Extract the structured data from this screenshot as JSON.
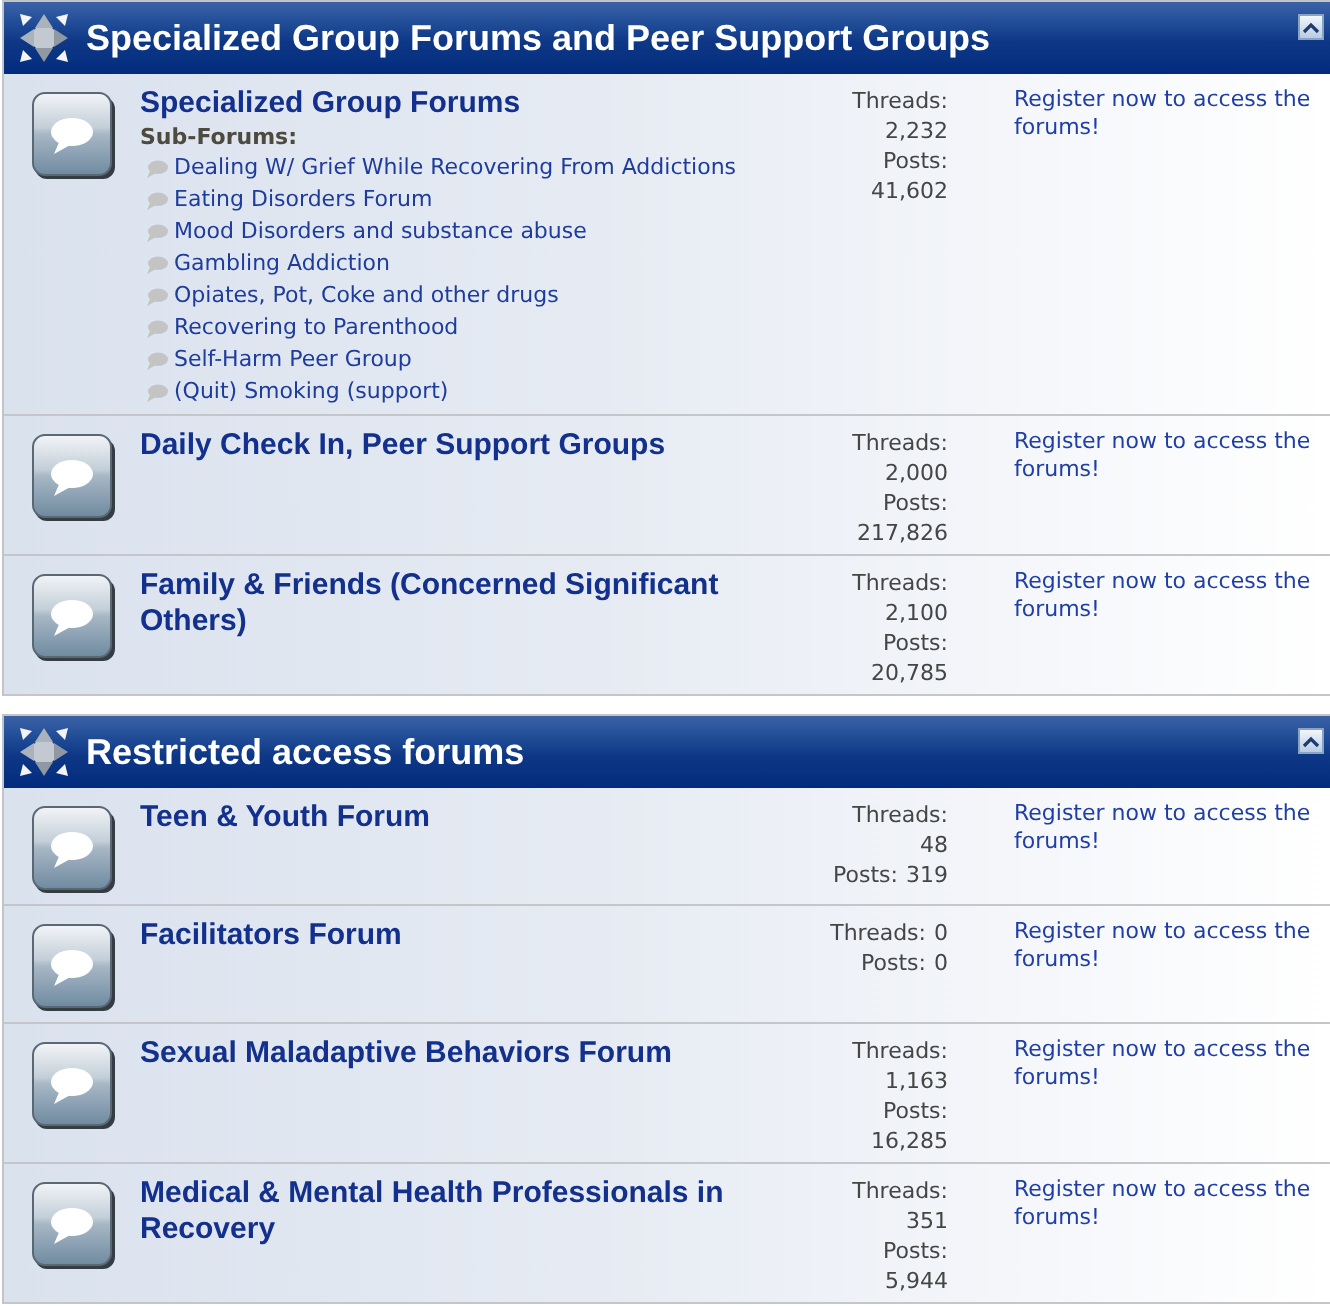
{
  "sections": [
    {
      "title": "Specialized Group Forums and Peer Support Groups",
      "forums": [
        {
          "title": "Specialized Group Forums",
          "subforums_label": "Sub-Forums:",
          "subforums": [
            "Dealing W/ Grief While Recovering From Addictions",
            "Eating Disorders Forum",
            "Mood Disorders and substance abuse",
            "Gambling Addiction",
            "Opiates, Pot, Coke and other drugs",
            "Recovering to Parenthood",
            "Self-Harm Peer Group",
            "(Quit) Smoking (support)"
          ],
          "stats": {
            "threads_label": "Threads:",
            "threads": "2,232",
            "posts_label": "Posts:",
            "posts": "41,602"
          },
          "access_note": "Register now to access the forums!"
        },
        {
          "title": "Daily Check In, Peer Support Groups",
          "stats": {
            "threads_label": "Threads:",
            "threads": "2,000",
            "posts_label": "Posts:",
            "posts": "217,826"
          },
          "access_note": "Register now to access the forums!"
        },
        {
          "title": "Family & Friends (Concerned Significant Others)",
          "stats": {
            "threads_label": "Threads:",
            "threads": "2,100",
            "posts_label": "Posts:",
            "posts": "20,785"
          },
          "access_note": "Register now to access the forums!"
        }
      ]
    },
    {
      "title": "Restricted access forums",
      "forums": [
        {
          "title": "Teen & Youth Forum",
          "stats": {
            "threads_label": "Threads:",
            "threads": "48",
            "posts_label": "Posts:",
            "posts": "319"
          },
          "access_note": "Register now to access the forums!"
        },
        {
          "title": "Facilitators Forum",
          "stats": {
            "threads_label": "Threads:",
            "threads": "0",
            "posts_label": "Posts:",
            "posts": "0"
          },
          "access_note": "Register now to access the forums!"
        },
        {
          "title": "Sexual Maladaptive Behaviors Forum",
          "stats": {
            "threads_label": "Threads:",
            "threads": "1,163",
            "posts_label": "Posts:",
            "posts": "16,285"
          },
          "access_note": "Register now to access the forums!"
        },
        {
          "title": "Medical & Mental Health Professionals in Recovery",
          "stats": {
            "threads_label": "Threads:",
            "threads": "351",
            "posts_label": "Posts:",
            "posts": "5,944"
          },
          "access_note": "Register now to access the forums!"
        }
      ]
    }
  ]
}
